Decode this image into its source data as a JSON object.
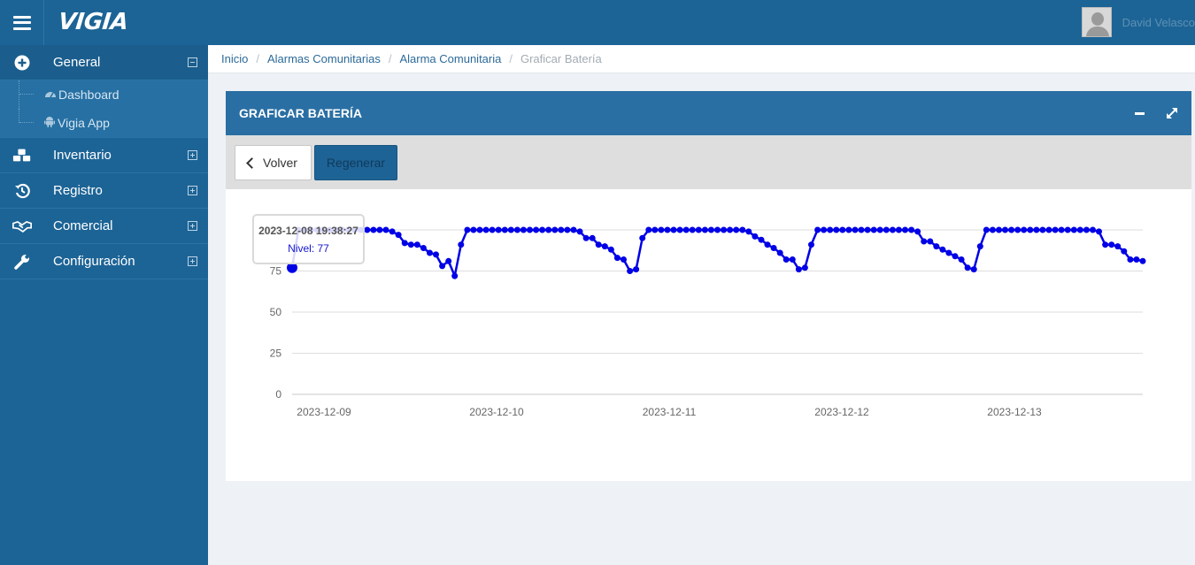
{
  "app": {
    "title": "VIGIA"
  },
  "user": {
    "name": "David Velasco"
  },
  "sidebar": {
    "items": [
      {
        "label": "General",
        "icon": "plus-circle-icon",
        "expanded": true,
        "children": [
          {
            "label": "Dashboard",
            "icon": "dashboard-icon"
          },
          {
            "label": "Vigia App",
            "icon": "android-icon"
          }
        ]
      },
      {
        "label": "Inventario",
        "icon": "cubes-icon"
      },
      {
        "label": "Registro",
        "icon": "history-icon"
      },
      {
        "label": "Comercial",
        "icon": "handshake-icon"
      },
      {
        "label": "Configuración",
        "icon": "wrench-icon"
      }
    ]
  },
  "breadcrumb": {
    "items": [
      "Inicio",
      "Alarmas Comunitarias",
      "Alarma Comunitaria"
    ],
    "current": "Graficar Batería"
  },
  "panel": {
    "title": "GRAFICAR BATERÍA",
    "back_label": "Volver",
    "regen_label": "Regenerar"
  },
  "tooltip": {
    "date": "2023-12-08 19:38:27",
    "value": "Nivel: 77"
  },
  "colors": {
    "series": "#0000e6",
    "header": "#1d6496",
    "panel_header": "#2a6fa3"
  },
  "chart_data": {
    "type": "line",
    "title": "",
    "xlabel": "",
    "ylabel": "",
    "ylim": [
      0,
      100
    ],
    "yticks": [
      0,
      25,
      50,
      75,
      100
    ],
    "xticks": [
      "2023-12-09",
      "2023-12-10",
      "2023-12-11",
      "2023-12-12",
      "2023-12-13"
    ],
    "grid": true,
    "legend": "none",
    "series": [
      {
        "name": "Nivel",
        "values": [
          77,
          100,
          100,
          100,
          100,
          100,
          100,
          100,
          100,
          100,
          100,
          100,
          100,
          100,
          100,
          100,
          99,
          97,
          92,
          91,
          91,
          89,
          86,
          85,
          78,
          81,
          72,
          91,
          100,
          100,
          100,
          100,
          100,
          100,
          100,
          100,
          100,
          100,
          100,
          100,
          100,
          100,
          100,
          100,
          100,
          100,
          99,
          95,
          95,
          91,
          90,
          88,
          83,
          82,
          75,
          76,
          95,
          100,
          100,
          100,
          100,
          100,
          100,
          100,
          100,
          100,
          100,
          100,
          100,
          100,
          100,
          100,
          100,
          99,
          96,
          94,
          91,
          89,
          86,
          82,
          82,
          76,
          77,
          91,
          100,
          100,
          100,
          100,
          100,
          100,
          100,
          100,
          100,
          100,
          100,
          100,
          100,
          100,
          100,
          100,
          99,
          93,
          93,
          90,
          88,
          86,
          84,
          82,
          77,
          76,
          90,
          100,
          100,
          100,
          100,
          100,
          100,
          100,
          100,
          100,
          100,
          100,
          100,
          100,
          100,
          100,
          100,
          100,
          100,
          99,
          91,
          91,
          90,
          87,
          82,
          82,
          81
        ]
      }
    ],
    "start_value_highlight": 77
  }
}
